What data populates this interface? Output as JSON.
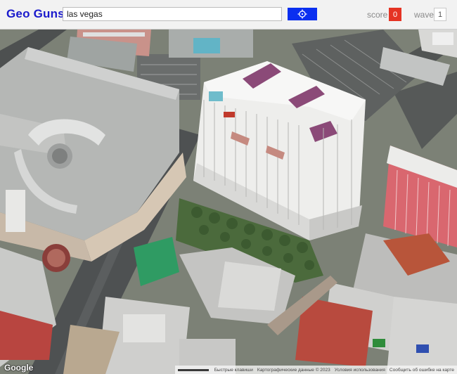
{
  "app": {
    "logo": "Geo Guns",
    "search_value": "las vegas",
    "score_label": "score",
    "score_value": "0",
    "wave_label": "wave",
    "wave_value": "1",
    "go_icon": "crosshair-icon",
    "accent_color": "#0a2ff0",
    "score_color": "#e53323"
  },
  "map": {
    "view": "aerial-3d",
    "google_logo": "Google",
    "attribution": {
      "keyboard_shortcuts": "Быстрые клавиши",
      "map_data": "Картографические данные © 2023",
      "terms": "Условия использования",
      "report_error": "Сообщить об ошибке на карте"
    }
  }
}
